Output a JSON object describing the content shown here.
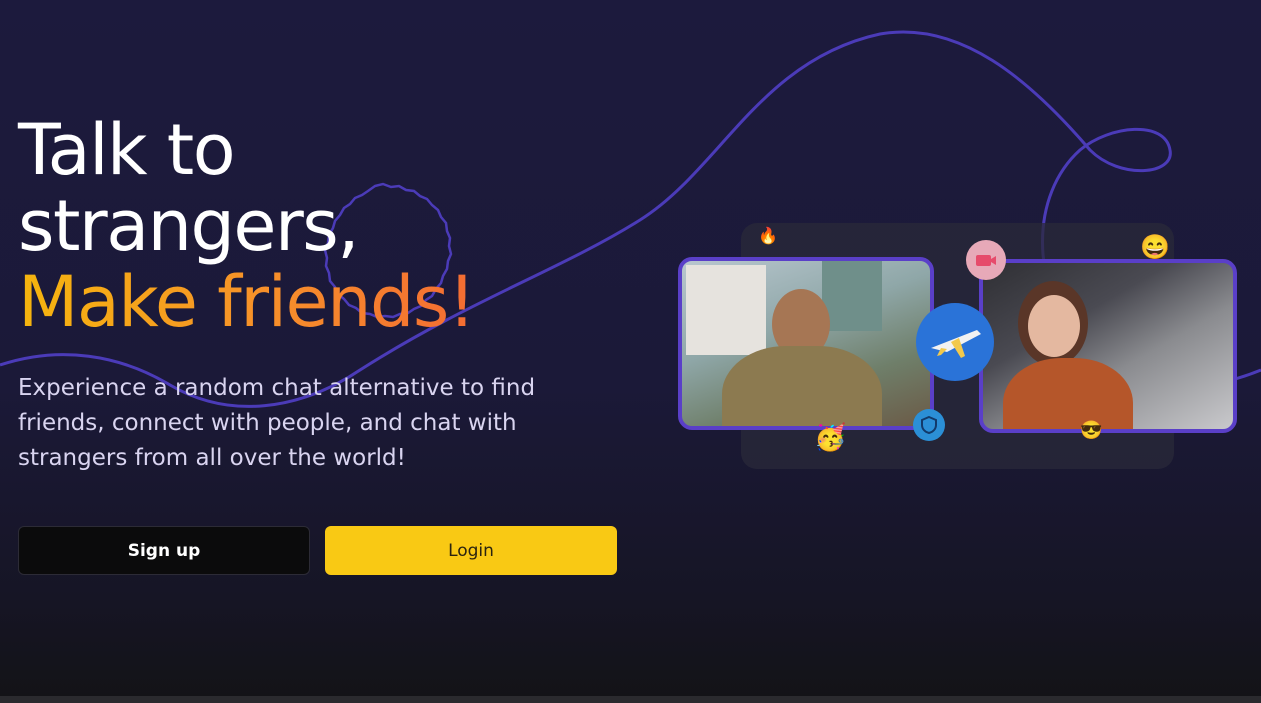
{
  "hero": {
    "headline_line1": "Talk to",
    "headline_line2": "strangers,",
    "headline_line3": "Make friends!",
    "subtitle": "Experience a random chat alternative to find friends, connect with people, and chat with strangers from all over the world!"
  },
  "buttons": {
    "signup_label": "Sign up",
    "login_label": "Login"
  },
  "colors": {
    "background": "#1c1a3d",
    "accent_yellow": "#f9c914",
    "accent_gradient_start": "#f5b50e",
    "accent_gradient_end": "#f1503a",
    "curve": "#4b3bb8",
    "photo_frame": "#5a3fc8"
  },
  "illustration": {
    "icons": [
      "fire-emoji",
      "grinning-emoji",
      "video-badge-icon",
      "airplane-globe-icon",
      "shield-icon",
      "party-emoji",
      "sunglasses-emoji"
    ],
    "emojis": {
      "fire": "🔥",
      "grinning": "😄",
      "party": "🥳",
      "sunglasses": "😎"
    }
  }
}
